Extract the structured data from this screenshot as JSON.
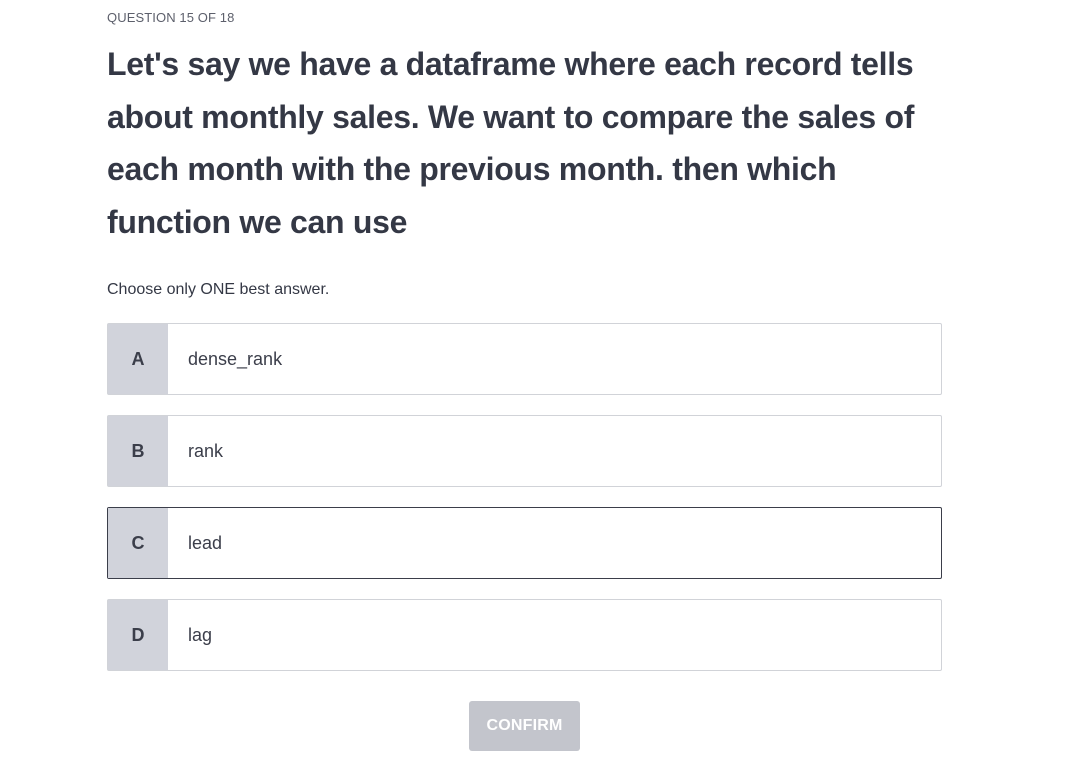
{
  "header": {
    "counter": "QUESTION 15 OF 18"
  },
  "question": {
    "text": "Let's say we have a dataframe where each record tells about monthly sales. We want to compare the sales of each month with the previous month. then which function we can use",
    "instruction": "Choose only ONE best answer."
  },
  "options": [
    {
      "letter": "A",
      "label": "dense_rank",
      "selected": false
    },
    {
      "letter": "B",
      "label": "rank",
      "selected": false
    },
    {
      "letter": "C",
      "label": "lead",
      "selected": true
    },
    {
      "letter": "D",
      "label": "lag",
      "selected": false
    }
  ],
  "actions": {
    "confirm_label": "CONFIRM"
  },
  "colors": {
    "letter_background": "#d1d3db",
    "selected_border": "#3b3e4a",
    "default_border": "#d1d3d8",
    "confirm_background": "#c3c5cc"
  }
}
